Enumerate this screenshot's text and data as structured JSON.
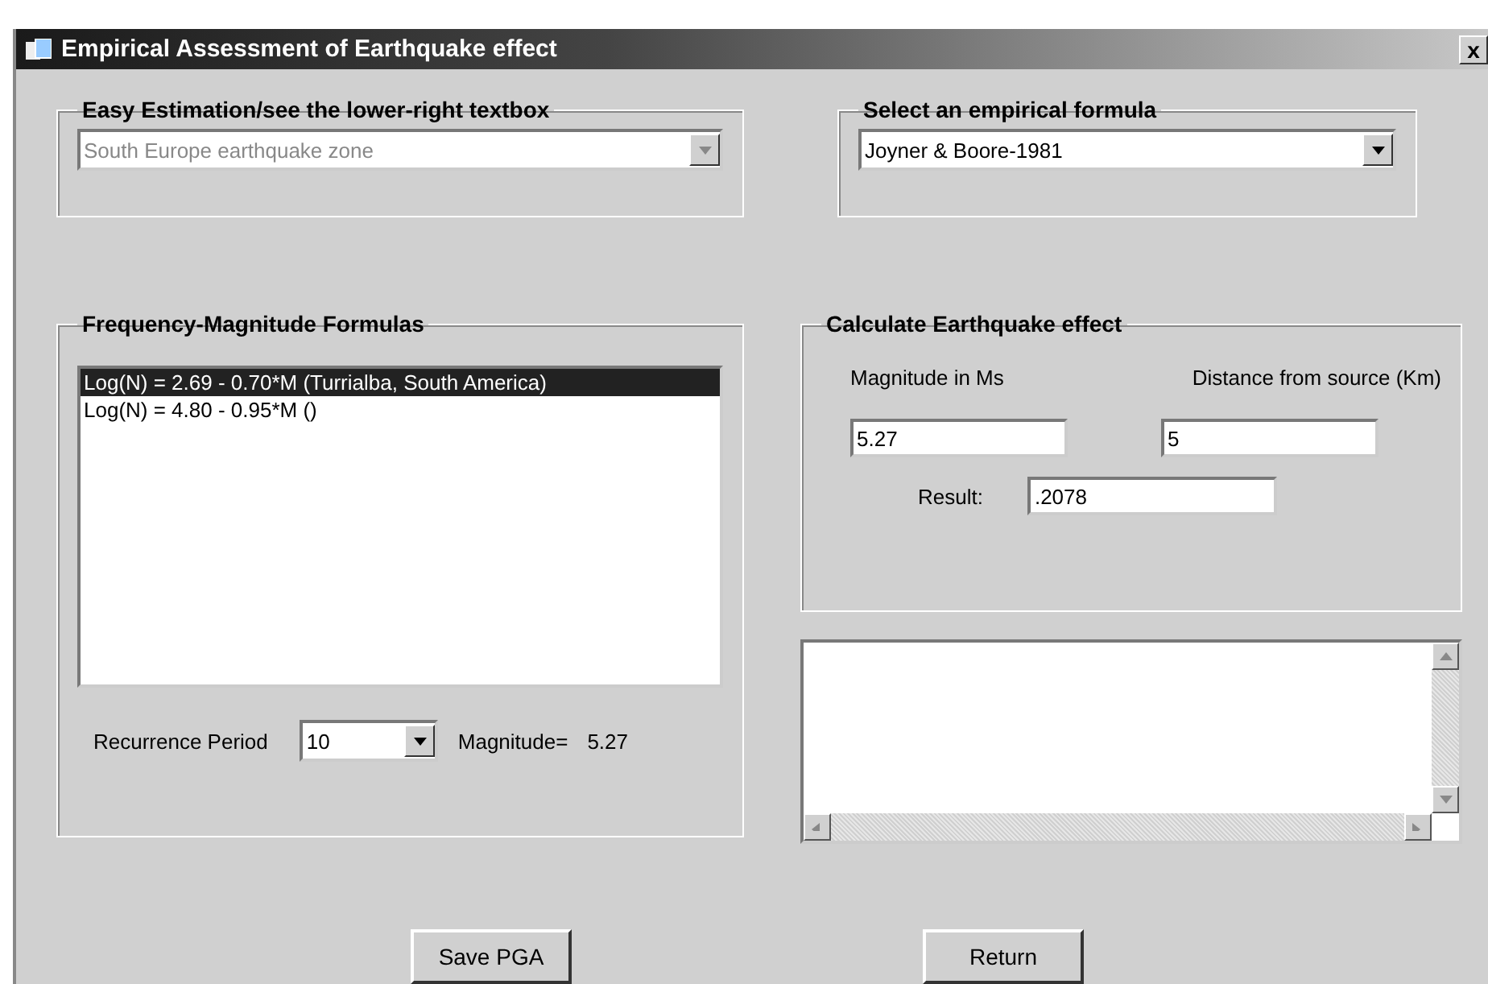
{
  "window": {
    "title": "Empirical Assessment of Earthquake effect",
    "close": "x"
  },
  "zone_group": {
    "title": "Easy Estimation/see the lower-right textbox",
    "value": "South Europe earthquake zone",
    "disabled": true
  },
  "formula_group": {
    "title": "Select an empirical formula",
    "value": "Joyner & Boore-1981",
    "disabled": false
  },
  "frequency_group": {
    "title": "Frequency-Magnitude Formulas",
    "items": [
      {
        "label": "Log(N) = 2.69 - 0.70*M (Turrialba, South America)",
        "selected": true
      },
      {
        "label": "Log(N) = 4.80 - 0.95*M ()",
        "selected": false
      }
    ],
    "recurrence_label": "Recurrence Period",
    "recurrence_value": "10",
    "magnitude_label": "Magnitude=",
    "magnitude_value": "5.27"
  },
  "calc_group": {
    "title": "Calculate Earthquake effect",
    "magnitude_label": "Magnitude in Ms",
    "magnitude_value": "5.27",
    "distance_label": "Distance from source (Km)",
    "distance_value": "5",
    "result_label": "Result:",
    "result_value": ".2078"
  },
  "buttons": [
    "Save PGA",
    "Return"
  ]
}
